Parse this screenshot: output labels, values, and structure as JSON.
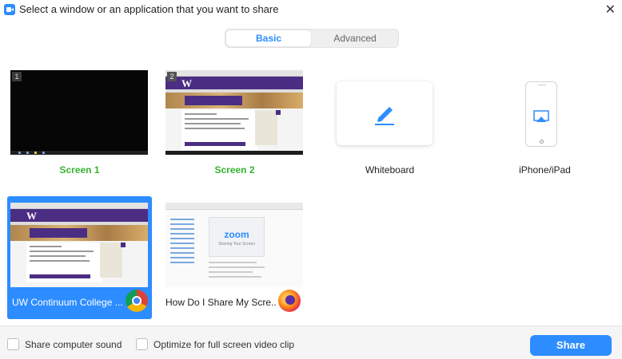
{
  "window": {
    "title": "Select a window or an application that you want to share",
    "close_icon": "close-icon",
    "app_icon": "zoom-camera-icon"
  },
  "tabs": [
    {
      "label": "Basic",
      "active": true
    },
    {
      "label": "Advanced",
      "active": false
    }
  ],
  "tiles": [
    {
      "label": "Screen 1",
      "badge": "1",
      "kind": "screen"
    },
    {
      "label": "Screen 2",
      "badge": "2",
      "kind": "screen"
    },
    {
      "label": "Whiteboard",
      "kind": "whiteboard",
      "icon": "pencil-icon"
    },
    {
      "label": "iPhone/iPad",
      "kind": "device",
      "icon": "airplay-icon"
    },
    {
      "label": "UW Continuum College ...",
      "kind": "window",
      "app_icon": "chrome-icon",
      "selected": true
    },
    {
      "label": "How Do I Share My Scre...",
      "kind": "window",
      "app_icon": "firefox-icon",
      "selected": false
    }
  ],
  "thumbs": {
    "uw_logo": "W",
    "zoom_logo": "zoom",
    "zoom_sub": "Sharing Your Screen"
  },
  "footer": {
    "share_sound": {
      "label": "Share computer sound",
      "checked": false
    },
    "optimize_video": {
      "label": "Optimize for full screen video clip",
      "checked": false
    },
    "share_button": "Share"
  },
  "colors": {
    "accent": "#2d8cff",
    "screen_label": "#35b32f",
    "uw_purple": "#4b2e83"
  }
}
